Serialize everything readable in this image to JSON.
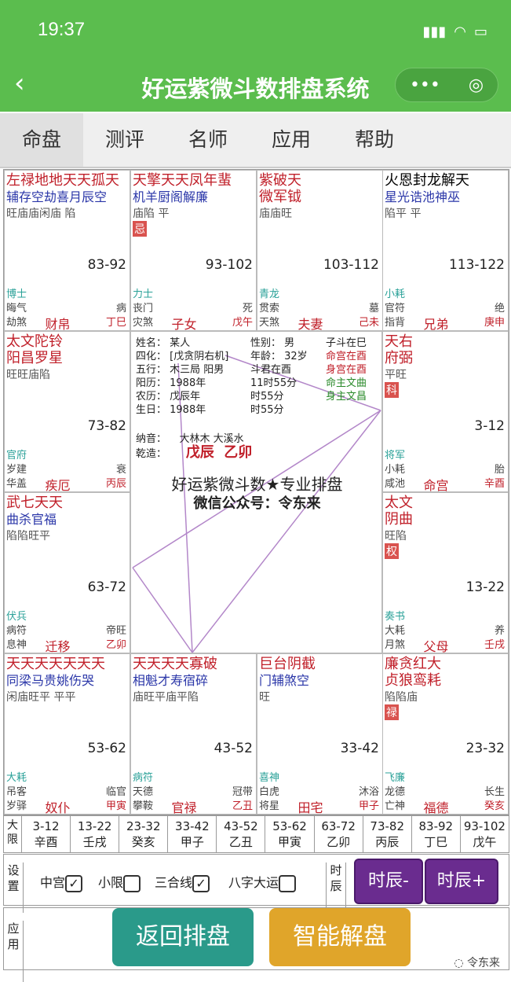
{
  "status": {
    "time": "19:37"
  },
  "nav": {
    "back": "‹",
    "title": "好运紫微斗数排盘系统",
    "more": "•••",
    "close": "◎"
  },
  "tabs": [
    "命盘",
    "测评",
    "名师",
    "应用",
    "帮助"
  ],
  "palaces": {
    "si": {
      "stars_major": "左禄地地天天孤天",
      "stars_line2": "辅存空劫喜月辰空",
      "bright": "旺庙庙闲庙  陷",
      "range": "83-92",
      "god": "博士",
      "r2l": "晦气",
      "r2r": "病",
      "r3l": "劫煞",
      "pal": "财帛",
      "stem": "丁巳"
    },
    "wu": {
      "stars_major": "天擎天天凤年蜚",
      "stars_line2": "机羊厨阁解廉",
      "bright": "庙陷  平",
      "hua": "忌",
      "range": "93-102",
      "god": "力士",
      "r2l": "丧门",
      "r2r": "死",
      "r3l": "灾煞",
      "pal": "子女",
      "stem": "戊午"
    },
    "wei": {
      "stars_major": "紫破天",
      "stars_line2": "微军钺",
      "bright": "庙庙旺",
      "range": "103-112",
      "god": "青龙",
      "r2l": "贯索",
      "r2r": "墓",
      "r3l": "天煞",
      "pal": "夫妻",
      "stem": "己未"
    },
    "shen": {
      "stars_major": "火恩封龙解天",
      "stars_line2": "星光诰池神巫",
      "bright": "陷平  平",
      "range": "113-122",
      "god": "小耗",
      "r2l": "官符",
      "r2r": "绝",
      "r3l": "指背",
      "pal": "兄弟",
      "stem": "庚申"
    },
    "chen": {
      "stars_major": "太文陀铃",
      "stars_line2": "阳昌罗星",
      "bright": "旺旺庙陷",
      "range": "73-82",
      "god": "官府",
      "r2l": "岁建",
      "r2r": "衰",
      "r3l": "华盖",
      "pal": "疾厄",
      "stem": "丙辰"
    },
    "you": {
      "stars_major": "天右",
      "stars_line2": "府弼",
      "bright": "平旺",
      "hua": "科",
      "range": "3-12",
      "god": "将军",
      "r2l": "小耗",
      "r2r": "胎",
      "r3l": "咸池",
      "pal": "命宫",
      "stem": "辛酉"
    },
    "mao": {
      "stars_major": "武七天天",
      "stars_line2": "曲杀官福",
      "bright": "陷陷旺平",
      "range": "63-72",
      "god": "伏兵",
      "r2l": "病符",
      "r2r": "帝旺",
      "r3l": "息神",
      "pal": "迁移",
      "stem": "乙卯"
    },
    "xu": {
      "stars_major": "太文",
      "stars_line2": "阴曲",
      "bright": "旺陷",
      "hua": "权",
      "range": "13-22",
      "god": "奏书",
      "r2l": "大耗",
      "r2r": "养",
      "r3l": "月煞",
      "pal": "父母",
      "stem": "壬戌"
    },
    "yin": {
      "stars_major": "天天天天天天天",
      "stars_line2": "同梁马贵姚伤哭",
      "bright": "闲庙旺平  平平",
      "range": "53-62",
      "god": "大耗",
      "r2l": "吊客",
      "r2r": "临官",
      "r3l": "岁驿",
      "pal": "奴仆",
      "stem": "甲寅"
    },
    "chou": {
      "stars_major": "天天天天寡破",
      "stars_line2": "相魁才寿宿碎",
      "bright": "庙旺平庙平陷",
      "range": "43-52",
      "god": "病符",
      "r2l": "天德",
      "r2r": "冠带",
      "r3l": "攀鞍",
      "pal": "官禄",
      "stem": "乙丑"
    },
    "zi": {
      "stars_major": "巨台阴截",
      "stars_line2": "门辅煞空",
      "bright": "旺",
      "range": "33-42",
      "god": "喜神",
      "r2l": "白虎",
      "r2r": "沐浴",
      "r3l": "将星",
      "pal": "田宅",
      "stem": "甲子"
    },
    "hai": {
      "stars_major": "廉贪红大",
      "stars_line2": "贞狼鸾耗",
      "bright": "陷陷庙",
      "hua": "禄",
      "range": "23-32",
      "god": "飞廉",
      "r2l": "龙德",
      "r2r": "长生",
      "r3l": "亡神",
      "pal": "福德",
      "stem": "癸亥"
    }
  },
  "center": {
    "name": "姓名：  某人",
    "sihua": "四化：  [戊贪阴右机]",
    "wuxing": "五行：  木三局  阳男",
    "yangli": "阳历：  1988年",
    "nongli": "农历：  戊辰年",
    "birth": "生日：  1988年",
    "gender": "性别：  男",
    "age": "年龄：  32岁",
    "time1": "11时55分",
    "time2": "时55分",
    "ziDou": "子斗在巳",
    "mingGong": "命宫在酉",
    "shenGong": "身宫在酉",
    "mingZhu": "命主文曲",
    "shenZhu": "身主文昌",
    "shijun": "斗君在酉",
    "nayin": "纳音：",
    "nayin_v": "大林木  大溪水",
    "qianzao": "乾造：",
    "qz1": "戊辰",
    "qz2": "乙卯",
    "brand1": "好运紫微斗数★专业排盘",
    "brand2": "微信公众号：令东来"
  },
  "decades": {
    "label": "大限",
    "items": [
      {
        "r": "3-12",
        "s": "辛酉"
      },
      {
        "r": "13-22",
        "s": "壬戌"
      },
      {
        "r": "23-32",
        "s": "癸亥"
      },
      {
        "r": "33-42",
        "s": "甲子"
      },
      {
        "r": "43-52",
        "s": "乙丑"
      },
      {
        "r": "53-62",
        "s": "甲寅"
      },
      {
        "r": "63-72",
        "s": "乙卯"
      },
      {
        "r": "73-82",
        "s": "丙辰"
      },
      {
        "r": "83-92",
        "s": "丁巳"
      },
      {
        "r": "93-102",
        "s": "戊午"
      }
    ]
  },
  "settings": {
    "label": "设置",
    "zhonggong": "中宫",
    "xiaoxian": "小限",
    "sanhe": "三合线",
    "bazi": "八字大运",
    "shichen_label": "时辰",
    "prev": "时辰-",
    "next": "时辰+"
  },
  "app": {
    "label": "应用",
    "back": "返回排盘",
    "smart": "智能解盘",
    "watermark": "令东来"
  },
  "colors": {
    "green": "#5bbd4e",
    "purple": "#6a2c8f",
    "teal": "#2a9a8a",
    "gold": "#e0a52a"
  }
}
